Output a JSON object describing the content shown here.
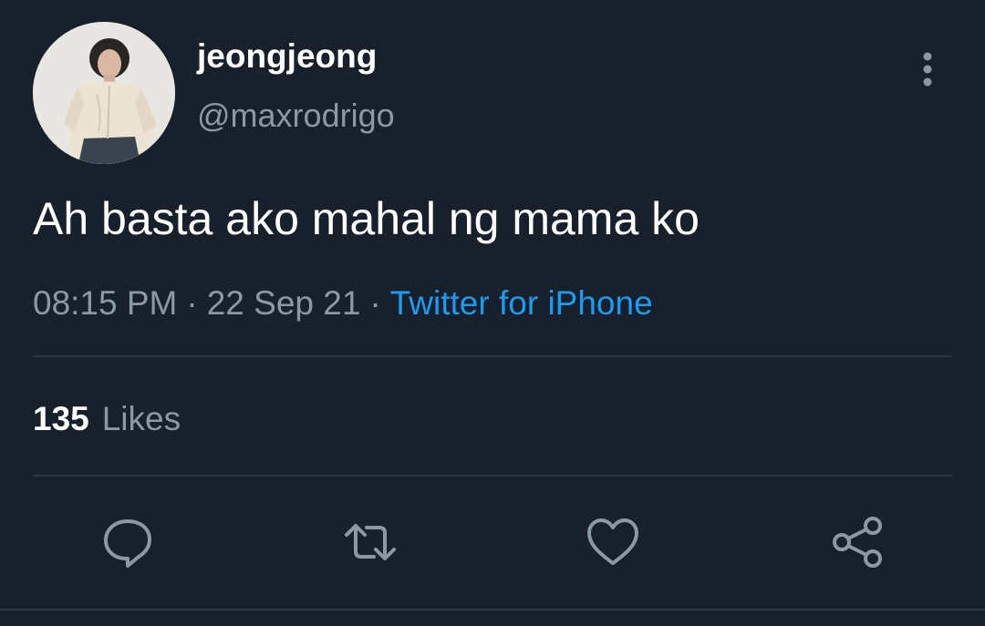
{
  "user": {
    "display_name": "jeongjeong",
    "handle": "@maxrodrigo"
  },
  "tweet": {
    "text": "Ah basta ako mahal ng mama ko",
    "time": "08:15 PM",
    "date": "22 Sep 21",
    "separator": "·",
    "source": "Twitter for iPhone"
  },
  "stats": {
    "likes_count": "135",
    "likes_label": "Likes"
  },
  "icons": {
    "more": "more-vertical-icon",
    "reply": "reply-icon",
    "retweet": "retweet-icon",
    "like": "heart-icon",
    "share": "share-icon"
  },
  "colors": {
    "background": "#17202b",
    "primary_text": "#ffffff",
    "secondary_text": "#8b98a5",
    "link": "#1d9bf0",
    "divider": "#2c3640"
  }
}
